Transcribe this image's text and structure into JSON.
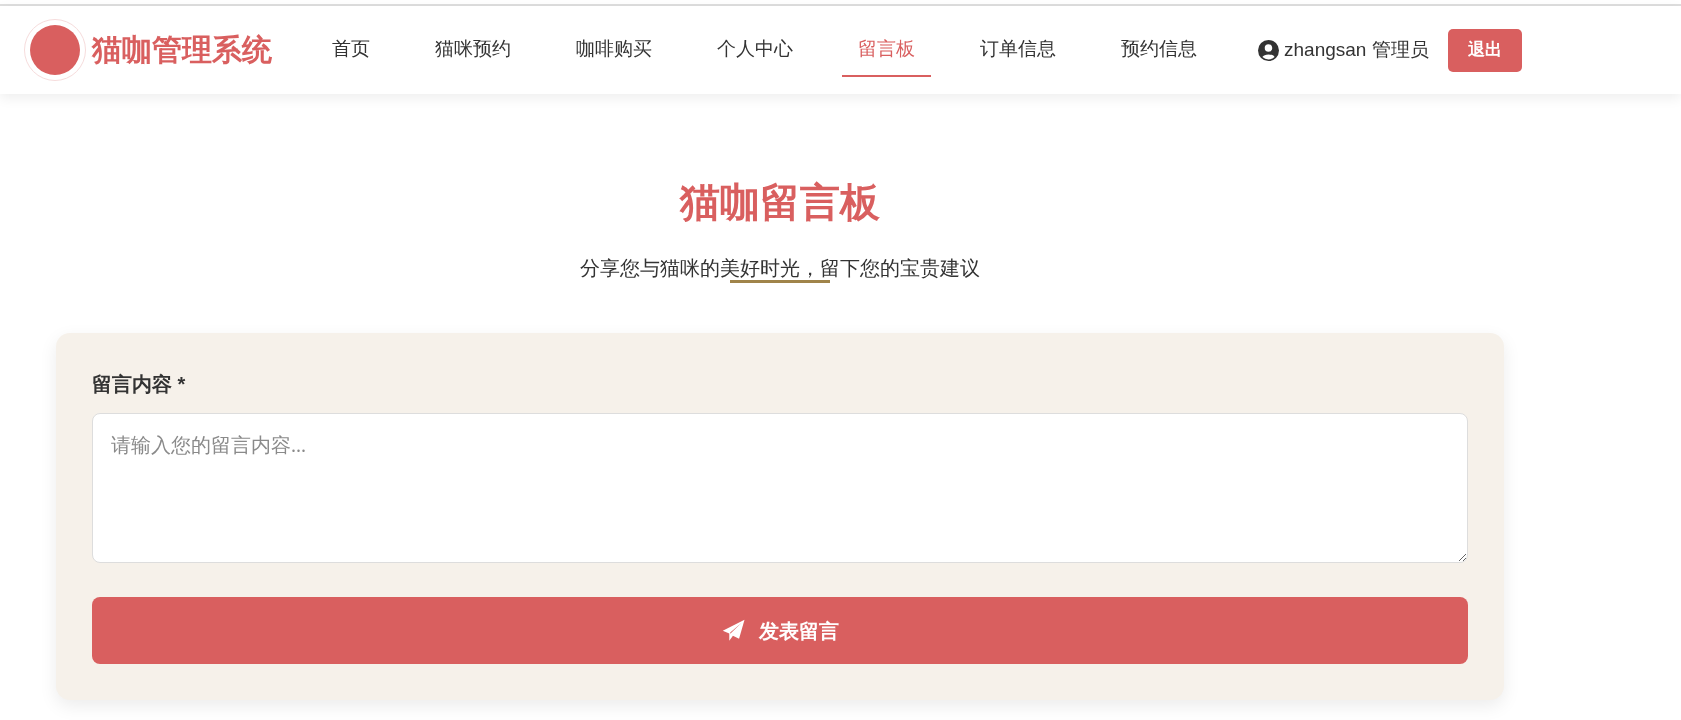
{
  "header": {
    "brand": "猫咖管理系统",
    "nav": [
      {
        "label": "首页",
        "selected": false
      },
      {
        "label": "猫咪预约",
        "selected": false
      },
      {
        "label": "咖啡购买",
        "selected": false
      },
      {
        "label": "个人中心",
        "selected": false
      },
      {
        "label": "留言板",
        "selected": true
      },
      {
        "label": "订单信息",
        "selected": false
      },
      {
        "label": "预约信息",
        "selected": false
      }
    ],
    "user": "zhangsan 管理员",
    "logout": "退出"
  },
  "page": {
    "title": "猫咖留言板",
    "subtitle": "分享您与猫咪的美好时光，留下您的宝贵建议"
  },
  "form": {
    "label": "留言内容 *",
    "placeholder": "请输入您的留言内容...",
    "submit": "发表留言"
  }
}
